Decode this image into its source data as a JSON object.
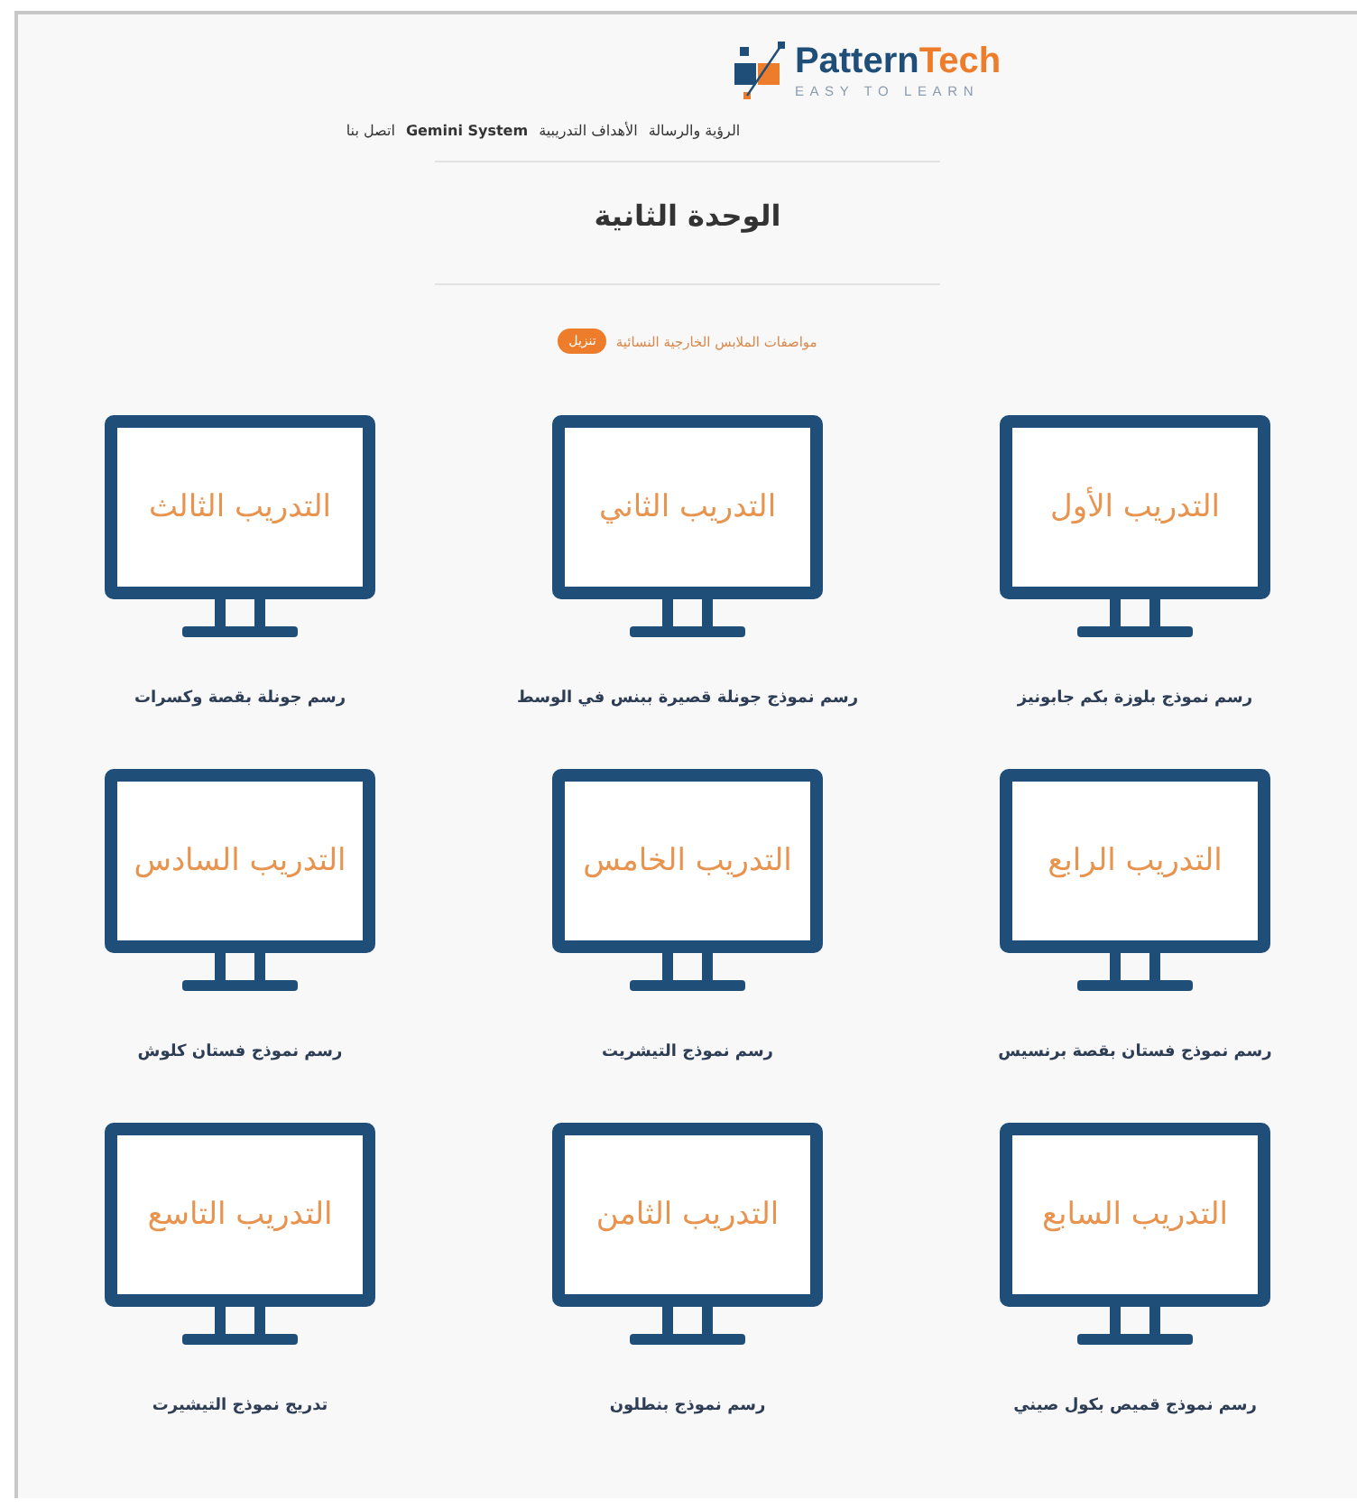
{
  "logo": {
    "name_blue": "Pattern",
    "name_orange": "Tech",
    "tagline": "EASY TO LEARN"
  },
  "nav": [
    {
      "label": "الرؤية والرسالة",
      "kind": "plain"
    },
    {
      "label": "الأهداف التدريبية",
      "kind": "plain"
    },
    {
      "label": "Gemini System",
      "kind": "bold"
    },
    {
      "label": "اتصل بنا",
      "kind": "plain"
    }
  ],
  "page_title": "الوحدة الثانية",
  "download": {
    "label": "مواصفات الملابس الخارجية النسائية",
    "button": "تنزيل"
  },
  "trainings": [
    {
      "screen_text": "التدريب الأول",
      "caption": "رسم نموذج بلوزة بكم جابونيز"
    },
    {
      "screen_text": "التدريب الثاني",
      "caption": "رسم نموذج جونلة قصيرة ببنس في الوسط"
    },
    {
      "screen_text": "التدريب الثالث",
      "caption": "رسم جونلة بقصة وكسرات"
    },
    {
      "screen_text": "التدريب الرابع",
      "caption": "رسم نموذج فستان بقصة برنسيس"
    },
    {
      "screen_text": "التدريب الخامس",
      "caption": "رسم نموذج التيشريت"
    },
    {
      "screen_text": "التدريب السادس",
      "caption": "رسم نموذج فستان كلوش"
    },
    {
      "screen_text": "التدريب السابع",
      "caption": "رسم نموذج قميص بكول صيني"
    },
    {
      "screen_text": "التدريب الثامن",
      "caption": "رسم نموذج بنطلون"
    },
    {
      "screen_text": "التدريب التاسع",
      "caption": "تدريج نموذج التيشيرت"
    }
  ]
}
